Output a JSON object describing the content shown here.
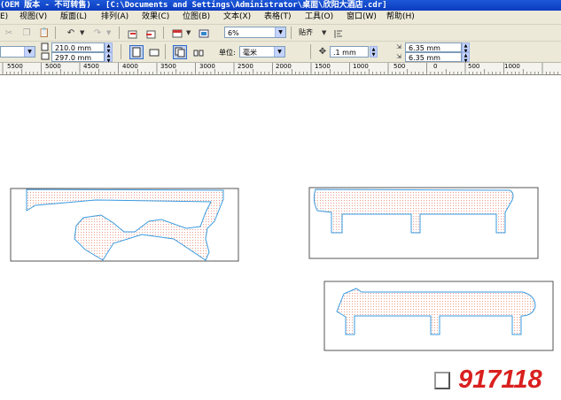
{
  "titlebar": {
    "text": "(OEM 版本 - 不可转售) - [C:\\Documents and Settings\\Administrator\\桌面\\欣阳大酒店.cdr]"
  },
  "menu": [
    {
      "label": "E)"
    },
    {
      "label": "视图(V)"
    },
    {
      "label": "版面(L)"
    },
    {
      "label": "排列(A)"
    },
    {
      "label": "效果(C)"
    },
    {
      "label": "位图(B)"
    },
    {
      "label": "文本(X)"
    },
    {
      "label": "表格(T)"
    },
    {
      "label": "工具(O)"
    },
    {
      "label": "窗口(W)"
    },
    {
      "label": "帮助(H)"
    }
  ],
  "toolbar": {
    "zoom": "6%",
    "snap_label": "贴齐"
  },
  "propbar": {
    "width": "210.0 mm",
    "height": "297.0 mm",
    "unit_label": "单位:",
    "unit_value": "毫米",
    "nudge": ".1 mm",
    "dup_x": "6.35 mm",
    "dup_y": "6.35 mm"
  },
  "ruler": {
    "labels": [
      "5500",
      "5000",
      "4500",
      "4000",
      "3500",
      "3000",
      "2500",
      "2000",
      "1500",
      "1000",
      "500",
      "0",
      "500",
      "1000"
    ]
  },
  "watermark": {
    "text": "917118"
  },
  "colors": {
    "title_bg": "#0a3bbf",
    "chrome_bg": "#ece9d8",
    "outline_blue": "#3a9be0",
    "dot_fill": "#e8836a",
    "watermark_red": "#d9201f"
  }
}
